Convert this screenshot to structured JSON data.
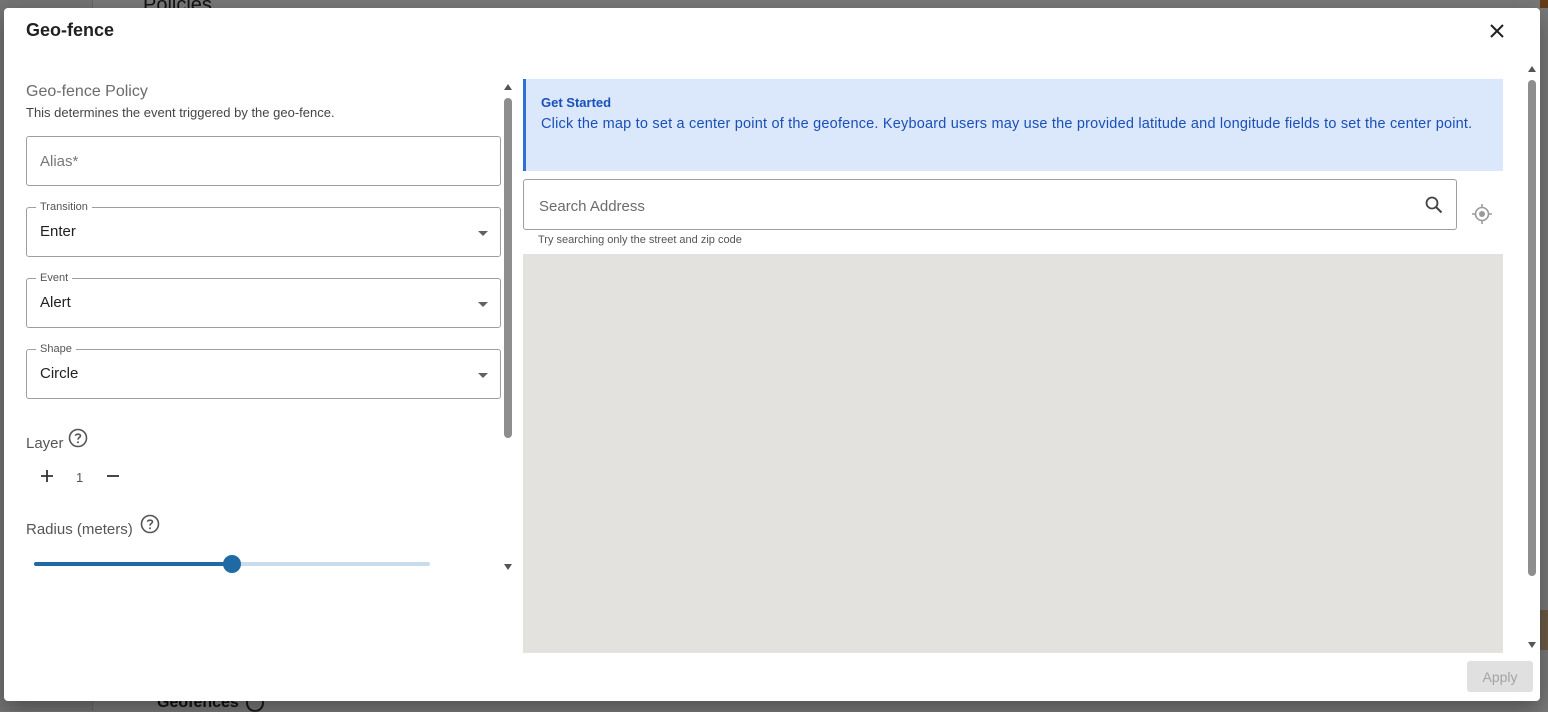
{
  "background": {
    "heading": "Policies",
    "footer_heading": "Geofences"
  },
  "dialog": {
    "title": "Geo-fence",
    "policy": {
      "title": "Geo-fence Policy",
      "description": "This determines the event triggered by the geo-fence."
    },
    "fields": {
      "alias": {
        "placeholder": "Alias*",
        "value": ""
      },
      "transition": {
        "label": "Transition",
        "value": "Enter"
      },
      "event": {
        "label": "Event",
        "value": "Alert"
      },
      "shape": {
        "label": "Shape",
        "value": "Circle"
      }
    },
    "layer": {
      "label": "Layer",
      "value": "1",
      "icons": [
        "plus-icon",
        "minus-icon",
        "help-circle-icon"
      ]
    },
    "radius": {
      "label": "Radius (meters)",
      "slider_fraction": 0.5
    },
    "info": {
      "title": "Get Started",
      "text": "Click the map to set a center point of the geofence. Keyboard users may use the provided latitude and longitude fields to set the center point."
    },
    "search": {
      "placeholder": "Search Address",
      "value": "",
      "hint": "Try searching only the street and zip code"
    },
    "apply_label": "Apply"
  },
  "colors": {
    "accent": "#1f6aa5",
    "info_bg": "#dbe8fb",
    "info_text": "#1a4fb8",
    "map_bg": "#e4e2de"
  }
}
